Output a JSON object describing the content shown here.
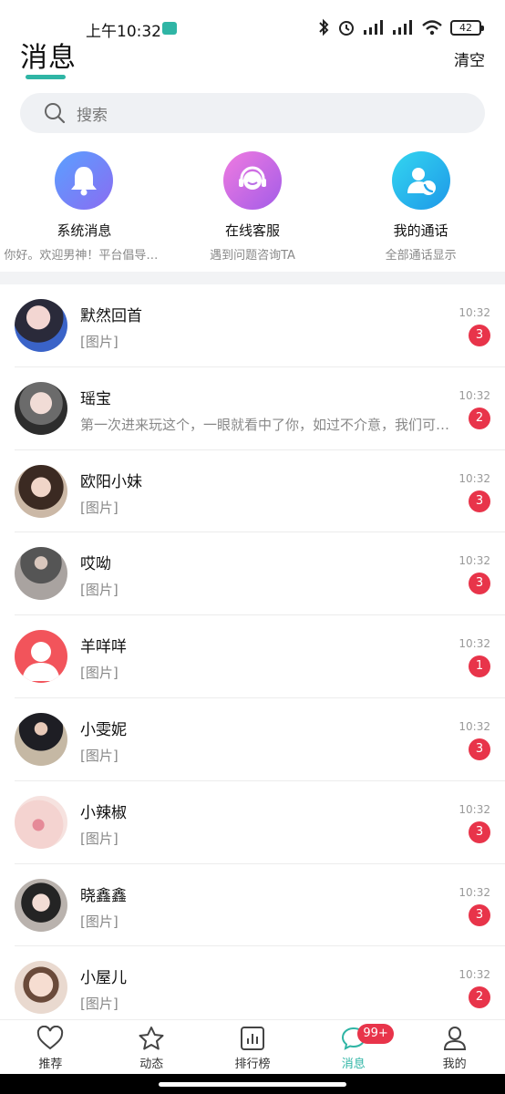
{
  "status_bar": {
    "time": "上午10:32",
    "battery": "42"
  },
  "header": {
    "title": "消息",
    "clear_label": "清空"
  },
  "search": {
    "placeholder": "搜索"
  },
  "shortcuts": [
    {
      "title": "系统消息",
      "subtitle": "你好。欢迎男神！平台倡导绿色交友",
      "icon": "bell-icon"
    },
    {
      "title": "在线客服",
      "subtitle": "遇到问题咨询TA",
      "icon": "headset-icon"
    },
    {
      "title": "我的通话",
      "subtitle": "全部通话显示",
      "icon": "phone-contact-icon"
    }
  ],
  "conversations": [
    {
      "name": "默然回首",
      "preview": "[图片]",
      "time": "10:32",
      "unread": "3"
    },
    {
      "name": "瑶宝",
      "preview": "第一次进来玩这个，一眼就看中了你，如过不介意，我们可以聊聊",
      "time": "10:32",
      "unread": "2"
    },
    {
      "name": "欧阳小妹",
      "preview": "[图片]",
      "time": "10:32",
      "unread": "3"
    },
    {
      "name": "哎呦",
      "preview": "[图片]",
      "time": "10:32",
      "unread": "3"
    },
    {
      "name": "羊咩咩",
      "preview": "[图片]",
      "time": "10:32",
      "unread": "1"
    },
    {
      "name": "小雯妮",
      "preview": "[图片]",
      "time": "10:32",
      "unread": "3"
    },
    {
      "name": "小辣椒",
      "preview": "[图片]",
      "time": "10:32",
      "unread": "3"
    },
    {
      "name": "晓鑫鑫",
      "preview": "[图片]",
      "time": "10:32",
      "unread": "3"
    },
    {
      "name": "小屋儿",
      "preview": "[图片]",
      "time": "10:32",
      "unread": "2"
    }
  ],
  "tabbar": {
    "items": [
      {
        "label": "推荐",
        "icon": "heart-icon"
      },
      {
        "label": "动态",
        "icon": "star-icon"
      },
      {
        "label": "排行榜",
        "icon": "chart-icon"
      },
      {
        "label": "消息",
        "icon": "chat-bubble-icon"
      },
      {
        "label": "我的",
        "icon": "person-icon"
      }
    ],
    "message_badge": "99+"
  },
  "colors": {
    "accent": "#2fb5a5",
    "badge": "#e8344a"
  }
}
